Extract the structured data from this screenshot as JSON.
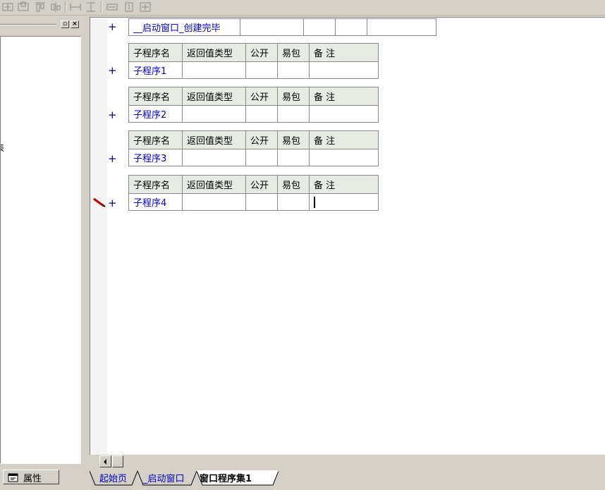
{
  "main_row": {
    "name": "__启动窗口_创建完毕"
  },
  "subroutines": [
    {
      "headers": [
        "子程序名",
        "返回值类型",
        "公开",
        "易包",
        "备 注"
      ],
      "name": "子程序1"
    },
    {
      "headers": [
        "子程序名",
        "返回值类型",
        "公开",
        "易包",
        "备 注"
      ],
      "name": "子程序2"
    },
    {
      "headers": [
        "子程序名",
        "返回值类型",
        "公开",
        "易包",
        "备 注"
      ],
      "name": "子程序3"
    },
    {
      "headers": [
        "子程序名",
        "返回值类型",
        "公开",
        "易包",
        "备 注"
      ],
      "name": "子程序4"
    }
  ],
  "expand_symbol": "+",
  "left_panel": {
    "partial_text": "表",
    "properties_tab": "属性"
  },
  "tabs": [
    {
      "label": "起始页",
      "color": "#0000c0"
    },
    {
      "label": "_启动窗口",
      "color": "#0000c0"
    },
    {
      "label": "窗口程序集1",
      "color": "#000000",
      "active": true
    }
  ],
  "colors": {
    "header_bg": "#e6ece3",
    "link_text": "#0000c0",
    "chrome": "#d4d0c8"
  }
}
